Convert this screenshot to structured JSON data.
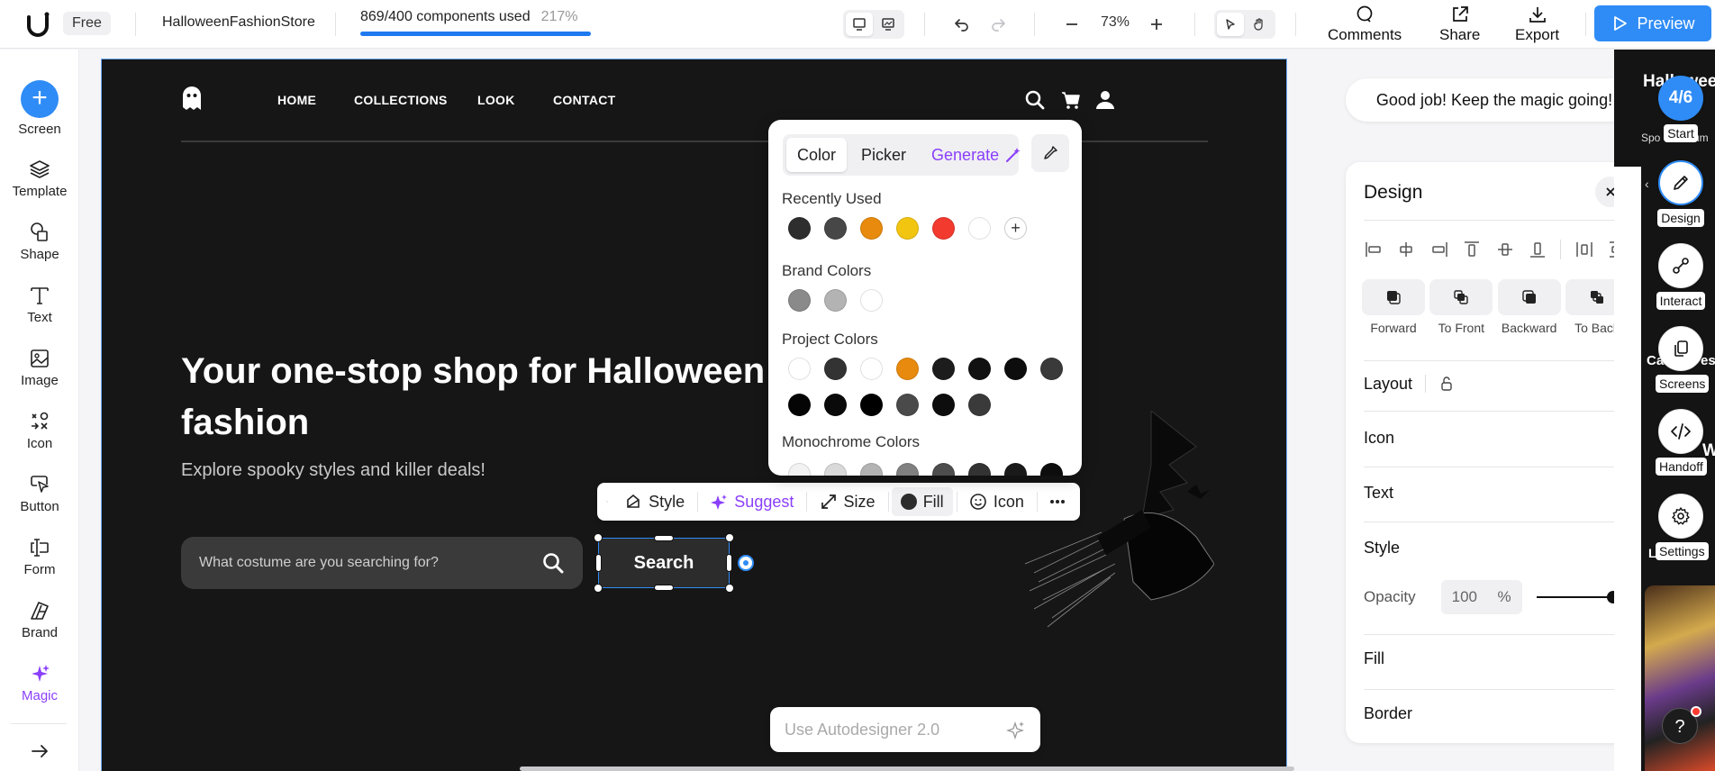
{
  "topbar": {
    "plan_badge": "Free",
    "project_name": "HalloweenFashionStore",
    "usage_text": "869/400 components used",
    "usage_percent": "217%",
    "usage_fill": 1.0,
    "zoom": "73%",
    "comments": "Comments",
    "share": "Share",
    "export": "Export",
    "preview": "Preview"
  },
  "left_tools": [
    {
      "label": "Screen"
    },
    {
      "label": "Template"
    },
    {
      "label": "Shape"
    },
    {
      "label": "Text"
    },
    {
      "label": "Image"
    },
    {
      "label": "Icon"
    },
    {
      "label": "Button"
    },
    {
      "label": "Form"
    },
    {
      "label": "Brand"
    },
    {
      "label": "Magic"
    }
  ],
  "site": {
    "nav": [
      "HOME",
      "COLLECTIONS",
      "LOOK",
      "CONTACT"
    ],
    "hero_title": "Your one-stop shop for Halloween fashion",
    "hero_subtitle": "Explore spooky styles and killer deals!",
    "search_placeholder": "What costume are you searching for?",
    "search_button": "Search"
  },
  "float_toolbar": {
    "style": "Style",
    "suggest": "Suggest",
    "size": "Size",
    "fill": "Fill",
    "icon": "Icon"
  },
  "color_popover": {
    "tabs": [
      "Color",
      "Picker",
      "Generate"
    ],
    "recently_used_label": "Recently Used",
    "recently_used": [
      "#2e2e2e",
      "#474747",
      "#e88a0d",
      "#f2c511",
      "#f23a2f",
      "#ffffff"
    ],
    "brand_label": "Brand Colors",
    "brand": [
      "#8a8a8a",
      "#b3b3b3",
      "#ffffff"
    ],
    "project_label": "Project Colors",
    "project_row1": [
      "#ffffff",
      "#333333",
      "#ffffff",
      "#e88a0d",
      "#1c1c1c",
      "#111111",
      "#0d0d0d",
      "#3a3a3a"
    ],
    "project_row2": [
      "#050505",
      "#0a0a0a",
      "#000000",
      "#4a4a4a",
      "#0d0d0d",
      "#3a3a3a"
    ],
    "mono_label": "Monochrome Colors",
    "mono": [
      "#f2f2f2",
      "#d9d9d9",
      "#b3b3b3",
      "#808080",
      "#4d4d4d",
      "#333333",
      "#1a1a1a",
      "#0d0d0d"
    ]
  },
  "autodesigner_placeholder": "Use Autodesigner 2.0",
  "toast": "Good job! Keep the magic going!",
  "design_panel": {
    "title": "Design",
    "arrange": [
      "Forward",
      "To Front",
      "Backward",
      "To Back"
    ],
    "sections": {
      "layout": "Layout",
      "icon": "Icon",
      "text": "Text",
      "style": "Style",
      "fill": "Fill",
      "border": "Border"
    },
    "opacity_label": "Opacity",
    "opacity_value": "100",
    "opacity_unit": "%"
  },
  "right_tools": {
    "step": "4/6",
    "start": "Start",
    "design": "Design",
    "interact": "Interact",
    "screens": "Screens",
    "handoff": "Handoff",
    "settings": "Settings"
  },
  "strip": {
    "title": "Hallowee",
    "sub": "Spo",
    "sub2": "um",
    "ca": "Ca",
    "es": "es",
    "w": "W",
    "l": "L"
  },
  "colors": {
    "accent": "#2f8cf6",
    "magic": "#8a3ffc",
    "site_bg": "#161616"
  }
}
